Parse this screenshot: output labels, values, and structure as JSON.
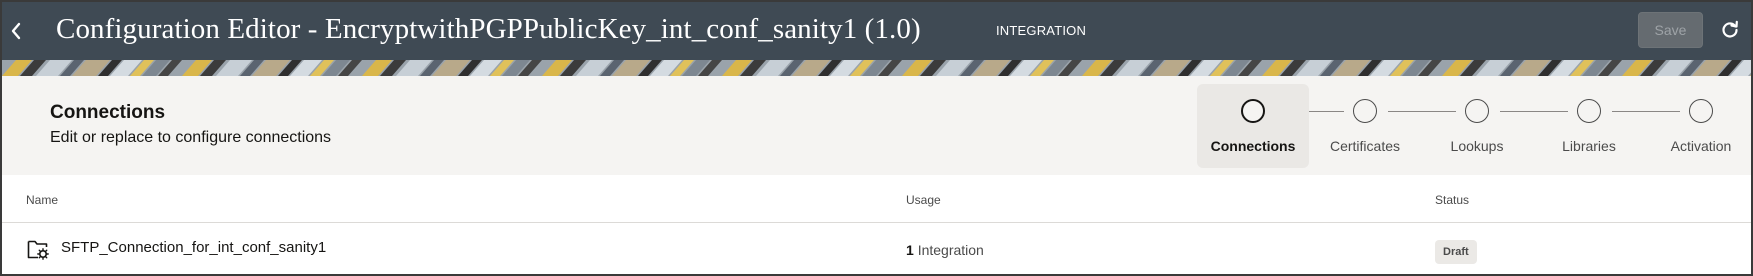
{
  "header": {
    "title": "Configuration Editor - EncryptwithPGPPublicKey_int_conf_sanity1 (1.0)",
    "type_badge": "INTEGRATION",
    "save_label": "Save",
    "back_icon": "chevron-left-icon",
    "refresh_icon": "refresh-icon",
    "background_color": "#3f4a54"
  },
  "section": {
    "title": "Connections",
    "subtitle": "Edit or replace to configure connections"
  },
  "stepper": {
    "steps": [
      {
        "label": "Connections",
        "active": true
      },
      {
        "label": "Certificates",
        "active": false
      },
      {
        "label": "Lookups",
        "active": false
      },
      {
        "label": "Libraries",
        "active": false
      },
      {
        "label": "Activation",
        "active": false
      }
    ]
  },
  "table": {
    "columns": {
      "name": "Name",
      "usage": "Usage",
      "status": "Status"
    },
    "rows": [
      {
        "name": "SFTP_Connection_for_int_conf_sanity1",
        "icon": "folder-connection-icon",
        "usage_count": "1",
        "usage_label": "Integration",
        "status": "Draft"
      }
    ]
  }
}
